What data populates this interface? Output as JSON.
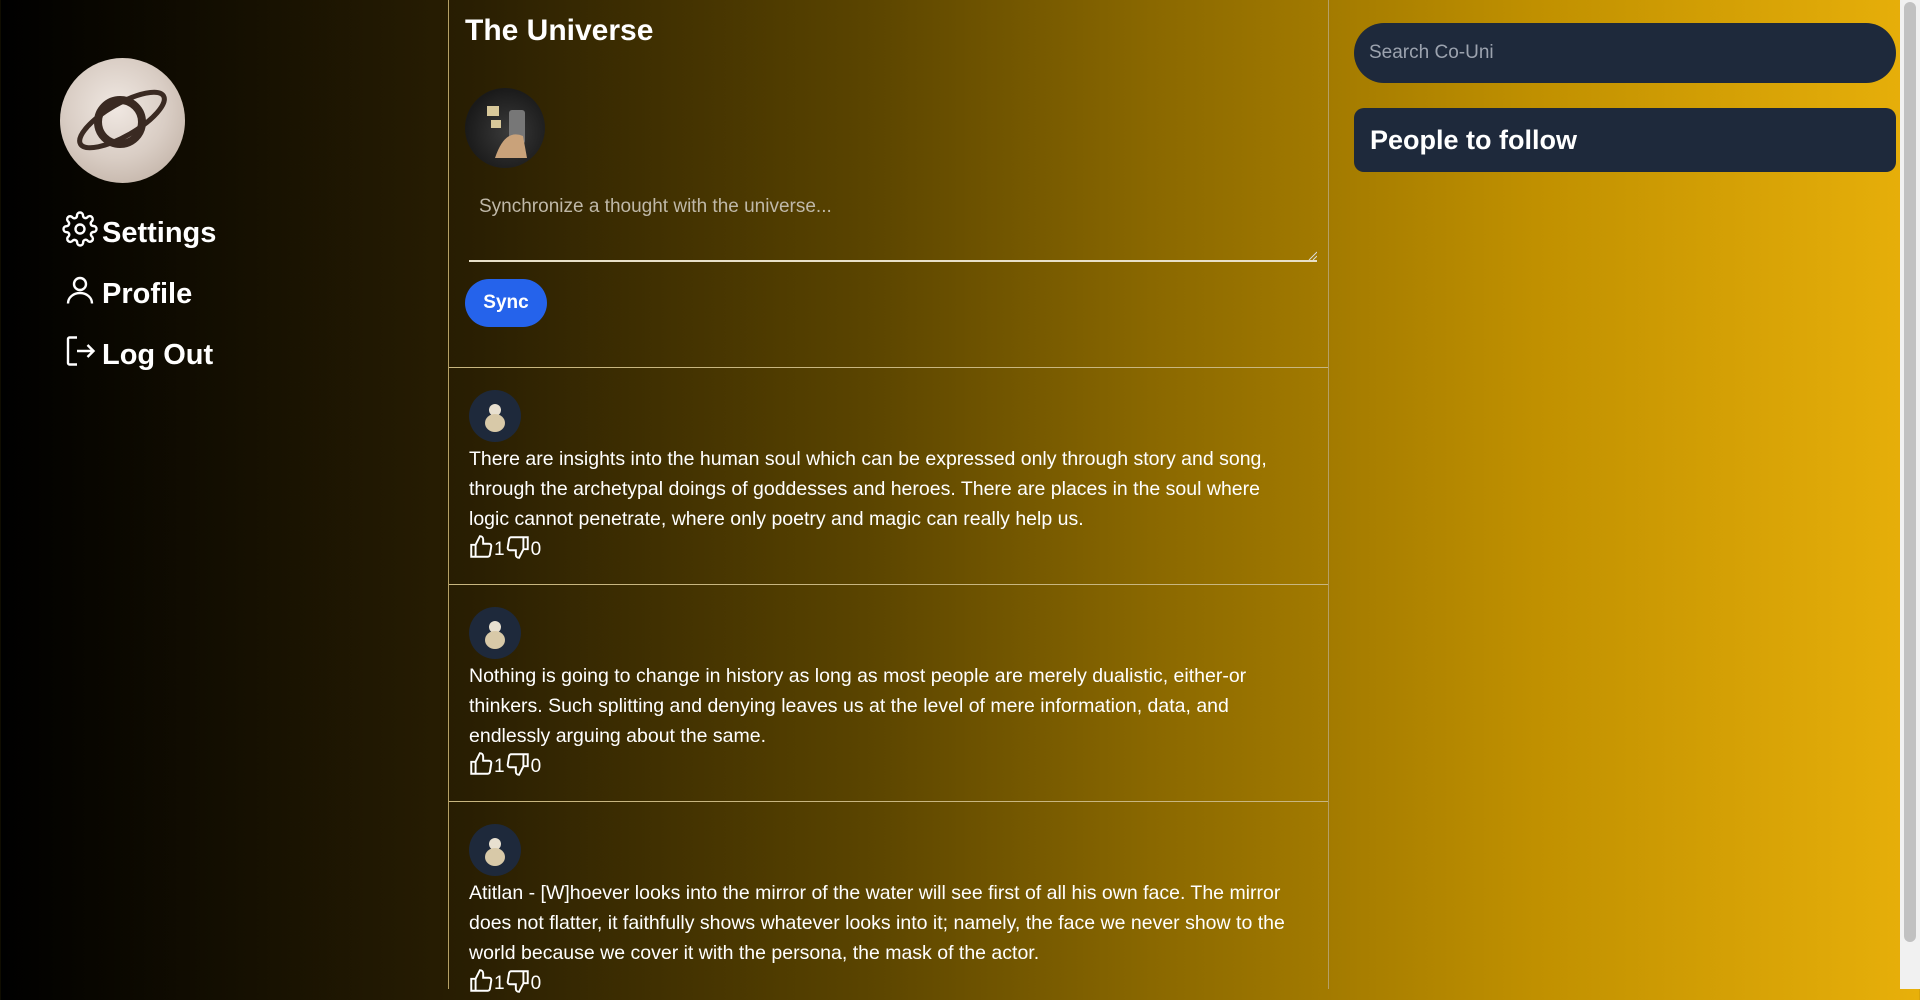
{
  "sidebar": {
    "logo": "planet-logo",
    "items": [
      {
        "label": "Settings",
        "icon": "gear-icon"
      },
      {
        "label": "Profile",
        "icon": "user-icon"
      },
      {
        "label": "Log Out",
        "icon": "logout-icon"
      }
    ]
  },
  "main": {
    "title": "The Universe",
    "composer": {
      "placeholder": "Synchronize a thought with the universe...",
      "submit_label": "Sync"
    },
    "posts": [
      {
        "text": "There are insights into the human soul which can be expressed only through story and song, through the archetypal doings of goddesses and heroes. There are places in the soul where logic cannot penetrate, where only poetry and magic can really help us.",
        "likes": "1",
        "dislikes": "0"
      },
      {
        "text": "Nothing is going to change in history as long as most people are merely dualistic, either-or thinkers. Such splitting and denying leaves us at the level of mere information, data, and endlessly arguing about the same.",
        "likes": "1",
        "dislikes": "0"
      },
      {
        "text": "Atitlan - [W]hoever looks into the mirror of the water will see first of all his own face. The mirror does not flatter, it faithfully shows whatever looks into it; namely, the face we never show to the world because we cover it with the persona, the mask of the actor.",
        "likes": "1",
        "dislikes": "0"
      }
    ]
  },
  "right": {
    "search_placeholder": "Search Co-Uni",
    "follow_title": "People to follow"
  },
  "colors": {
    "accent": "#2563eb",
    "card": "#1e293b",
    "gradient_start": "#000000",
    "gradient_end": "#e8b00a"
  }
}
